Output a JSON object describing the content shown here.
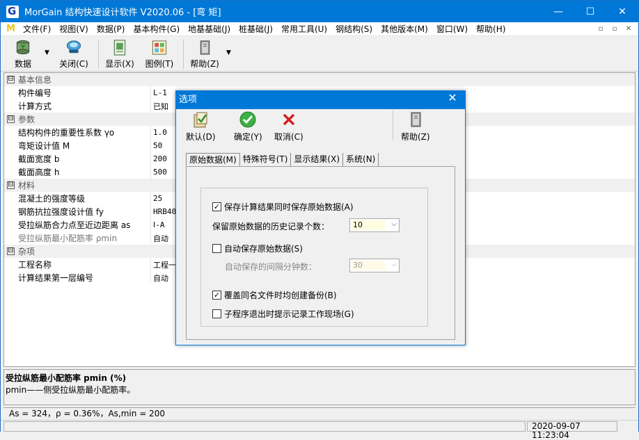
{
  "window": {
    "title": "MorGain 结构快速设计软件 V2020.06 - [弯 矩]",
    "minimize": "—",
    "maximize": "☐",
    "close": "✕"
  },
  "menu": {
    "logo": "M",
    "items": [
      "文件(F)",
      "视图(V)",
      "数据(P)",
      "基本构件(G)",
      "地基基础(J)",
      "桩基础(J)",
      "常用工具(U)",
      "钢结构(S)",
      "其他版本(M)",
      "窗口(W)",
      "帮助(H)"
    ],
    "mdi": [
      "▫",
      "▫",
      "✕"
    ]
  },
  "toolbar": {
    "data_label": "数据",
    "dropdown_arrow": "▼",
    "close_label": "关闭(C)",
    "display_label": "显示(X)",
    "legend_label": "图例(T)",
    "help_label": "帮助(Z)"
  },
  "grid": {
    "groups": {
      "basic": "基本信息",
      "params": "参数",
      "material": "材料",
      "misc": "杂项"
    },
    "toggle": "⊟",
    "rows": {
      "member_no": {
        "key": "构件编号",
        "val": "L-1"
      },
      "calc_method": {
        "key": "计算方式",
        "val": "已知"
      },
      "importance": {
        "key": "结构构件的重要性系数 γo",
        "val": "1.0"
      },
      "moment": {
        "key": "弯矩设计值 M",
        "val": "50"
      },
      "width": {
        "key": "截面宽度 b",
        "val": "200"
      },
      "height": {
        "key": "截面高度 h",
        "val": "500"
      },
      "concrete": {
        "key": "混凝土的强度等级",
        "val": "25"
      },
      "rebar": {
        "key": "钢筋抗拉强度设计值 fy",
        "val": "HRB400"
      },
      "cover": {
        "key": "受拉纵筋合力点至近边距离 as",
        "val": "Ⅰ-A"
      },
      "rho_min": {
        "key": "受拉纵筋最小配筋率 ρmin",
        "val": "自动"
      },
      "project": {
        "key": "工程名称",
        "val": "工程一"
      },
      "first_no": {
        "key": "计算结果第一层编号",
        "val": "自动"
      }
    }
  },
  "description": {
    "title": "受拉纵筋最小配筋率  pmin (%)",
    "text": "pmin——侧受拉纵筋最小配筋率。"
  },
  "calc_line": "As = 324，ρ = 0.36%，As,min = 200",
  "status": {
    "datetime": "2020-09-07 11:23:04"
  },
  "dialog": {
    "title": "选项",
    "close": "✕",
    "default_label": "默认(D)",
    "ok_label": "确定(Y)",
    "cancel_label": "取消(C)",
    "help_label": "帮助(Z)",
    "tabs": [
      "原始数据(M)",
      "特殊符号(T)",
      "显示结果(X)",
      "系统(N)"
    ],
    "save_original": {
      "label": "保存计算结果同时保存原始数据(A)",
      "checked": "✓"
    },
    "history_label": "保留原始数据的历史记录个数：",
    "history_value": "10",
    "auto_save": {
      "label": "自动保存原始数据(S)",
      "checked": ""
    },
    "interval_label": "自动保存的间隔分钟数：",
    "interval_value": "30",
    "backup": {
      "label": "覆盖同名文件时均创建备份(B)",
      "checked": "✓"
    },
    "prompt": {
      "label": "子程序退出时提示记录工作现场(G)",
      "checked": ""
    },
    "combo_arrow": "⌵"
  }
}
